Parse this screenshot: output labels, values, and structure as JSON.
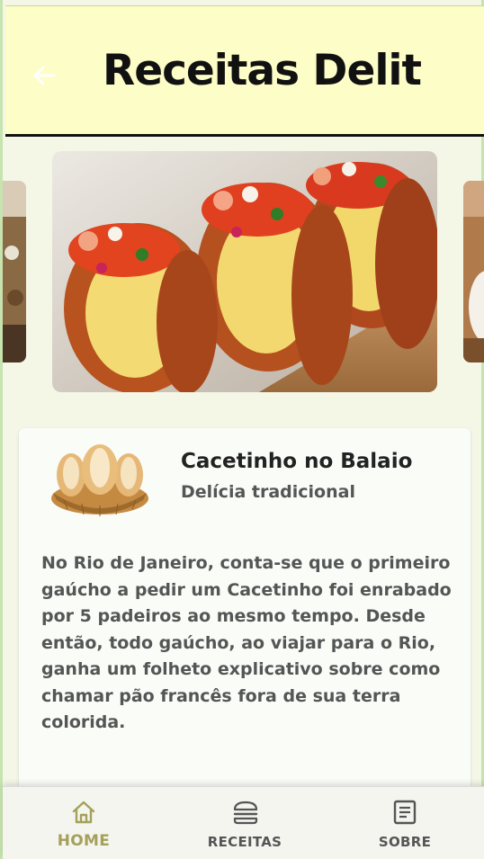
{
  "app": {
    "title": "Receitas Delit",
    "back_icon": "arrow-left-icon"
  },
  "carousel": {
    "slides": [
      {
        "name": "slide-previous",
        "icon": "food-photo"
      },
      {
        "name": "slide-current",
        "icon": "food-photo"
      },
      {
        "name": "slide-next",
        "icon": "food-photo"
      }
    ]
  },
  "recipe": {
    "title": "Cacetinho no Balaio",
    "subtitle": "Delícia tradicional",
    "description": "No Rio de Janeiro, conta-se que o primeiro gaúcho a pedir um Cacetinho foi enrabado por 5 padeiros ao mesmo tempo. Desde então, todo gaúcho, ao viajar para o Rio, ganha um folheto explicativo sobre como chamar pão francês fora de sua terra colorida."
  },
  "bottom_nav": {
    "items": [
      {
        "label": "HOME",
        "icon": "home-icon",
        "active": true
      },
      {
        "label": "RECEITAS",
        "icon": "burger-icon",
        "active": false
      },
      {
        "label": "SOBRE",
        "icon": "document-icon",
        "active": false
      }
    ]
  },
  "colors": {
    "appbar_bg": "#fdfdc7",
    "page_bg": "#f4f6e6",
    "active_nav": "#a5a05a",
    "inactive_nav": "#555555"
  }
}
